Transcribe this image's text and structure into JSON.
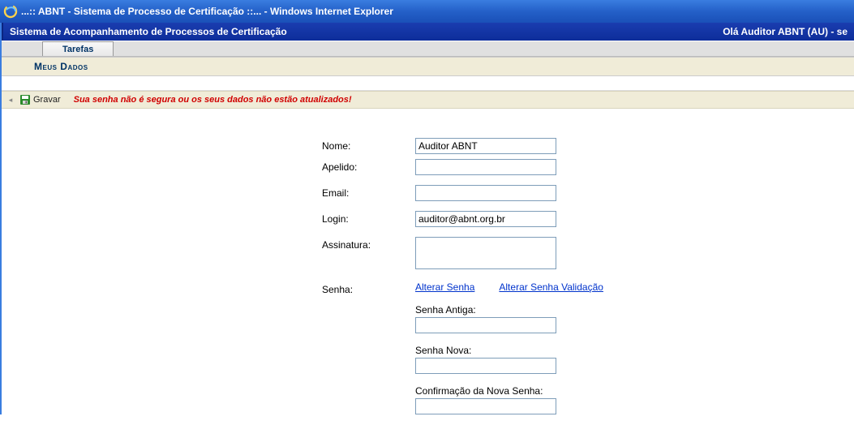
{
  "window": {
    "title": "...:: ABNT - Sistema de Processo de Certificação ::... - Windows Internet Explorer"
  },
  "header": {
    "system_name": "Sistema de Acompanhamento de Processos de Certificação",
    "greeting": "Olá Auditor ABNT (AU) - se"
  },
  "tabs": {
    "tasks": "Tarefas"
  },
  "subheader": {
    "title": "Meus Dados"
  },
  "actionbar": {
    "save_label": "Gravar",
    "warning": "Sua senha não é segura ou os seus dados não estão atualizados!"
  },
  "form": {
    "nome_label": "Nome:",
    "nome_value": "Auditor ABNT",
    "apelido_label": "Apelido:",
    "apelido_value": "",
    "email_label": "Email:",
    "email_value": "",
    "login_label": "Login:",
    "login_value": "auditor@abnt.org.br",
    "assinatura_label": "Assinatura:",
    "assinatura_value": "",
    "senha_label": "Senha:",
    "link_alterar": "Alterar Senha",
    "link_alterar_validacao": "Alterar Senha Validação",
    "senha_antiga_label": "Senha Antiga:",
    "senha_antiga_value": "",
    "senha_nova_label": "Senha Nova:",
    "senha_nova_value": "",
    "confirma_label": "Confirmação da Nova Senha:",
    "confirma_value": ""
  }
}
